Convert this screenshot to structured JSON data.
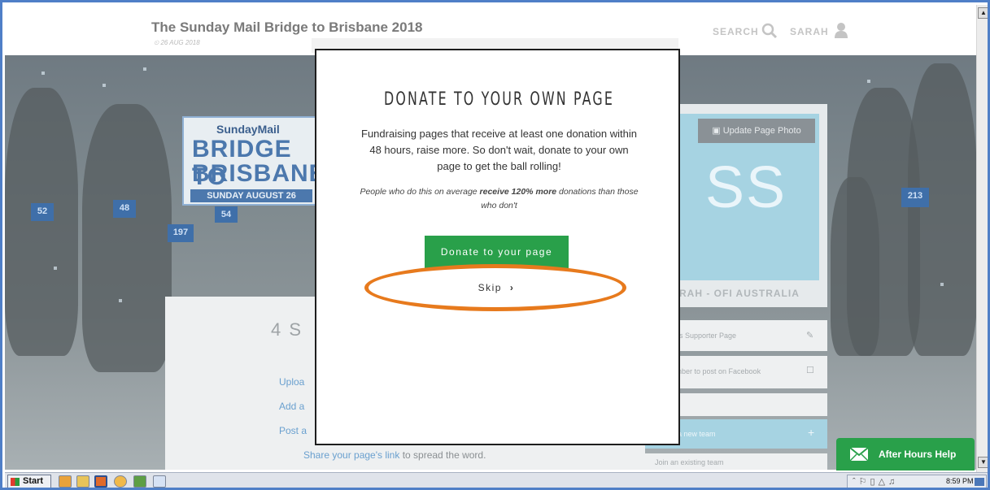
{
  "header": {
    "event_title": "The Sunday Mail Bridge to Brisbane 2018",
    "event_date": "⏲ 26 AUG 2018",
    "search_label": "SEARCH",
    "user_label": "SARAH"
  },
  "hero": {
    "logo": {
      "brand": "SundayMail",
      "line1": "BRIDGE TO",
      "line2": "BRISBANE",
      "date": "SUNDAY AUGUST 26"
    },
    "bibs": [
      "52",
      "48",
      "54",
      "197",
      "213"
    ]
  },
  "content": {
    "steps_title": "4 S",
    "steps": [
      "Uploa",
      "Add a",
      "Post a"
    ],
    "share_link": "Share your page's link",
    "share_rest": " to spread the word."
  },
  "sidebar": {
    "update_photo": "Update Page Photo",
    "initials": "SS",
    "profile_name": "RAH - OFI AUSTRALIA",
    "rows": [
      {
        "label": "is Supporter Page",
        "icon": "✎"
      },
      {
        "label": "nber to post on Facebook",
        "icon": "☐"
      },
      {
        "label": "a new team",
        "icon": "+"
      },
      {
        "label": "Join an existing team",
        "icon": ""
      }
    ]
  },
  "modal": {
    "title": "DONATE TO YOUR OWN PAGE",
    "body": "Fundraising pages that receive at least one donation within 48 hours, raise more. So don't wait, donate to your own page to get the ball rolling!",
    "note_prefix": "People who do this on average ",
    "note_bold": "receive 120% more",
    "note_suffix": " donations than those who don't",
    "donate_button": "Donate to your page",
    "skip_button": "Skip"
  },
  "chat": {
    "label": "After Hours Help"
  },
  "taskbar": {
    "start_label": "Start",
    "time": "8:59 PM"
  },
  "colors": {
    "accent_green": "#29a04a",
    "highlight_orange": "#e77a1d",
    "frame_blue": "#4f7fc7"
  }
}
